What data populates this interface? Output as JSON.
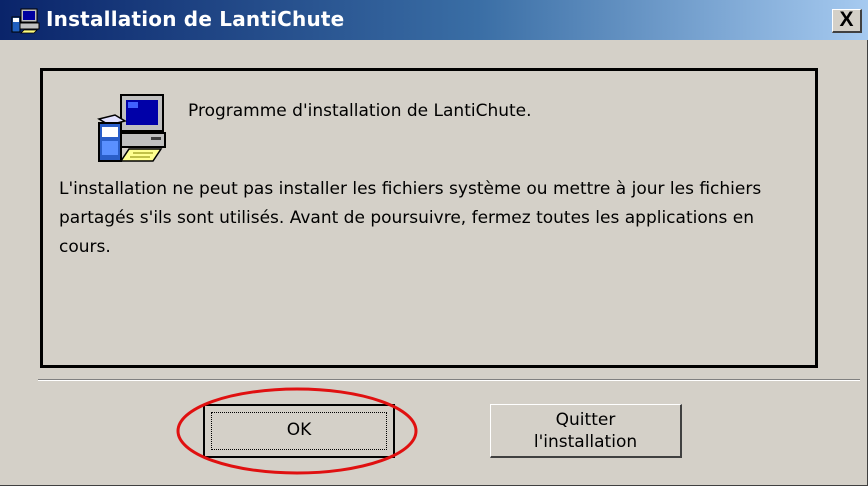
{
  "window": {
    "title": "Installation de LantiChute",
    "close_label": "X"
  },
  "content": {
    "heading": "Programme d'installation de LantiChute.",
    "message": "L'installation ne peut pas installer les fichiers système ou mettre à jour les fichiers partagés s'ils sont utilisés. Avant de poursuivre, fermez toutes les applications en cours."
  },
  "buttons": {
    "ok_label": "OK",
    "quit_line1": "Quitter",
    "quit_line2": "l'installation"
  },
  "colors": {
    "face": "#d4d0c8",
    "title_start": "#0a246a",
    "title_end": "#a6caf0",
    "highlight": "#e01010"
  },
  "icons": {
    "title_icon": "setup-computer-icon",
    "content_icon": "setup-computer-icon",
    "close_icon": "close-icon"
  }
}
